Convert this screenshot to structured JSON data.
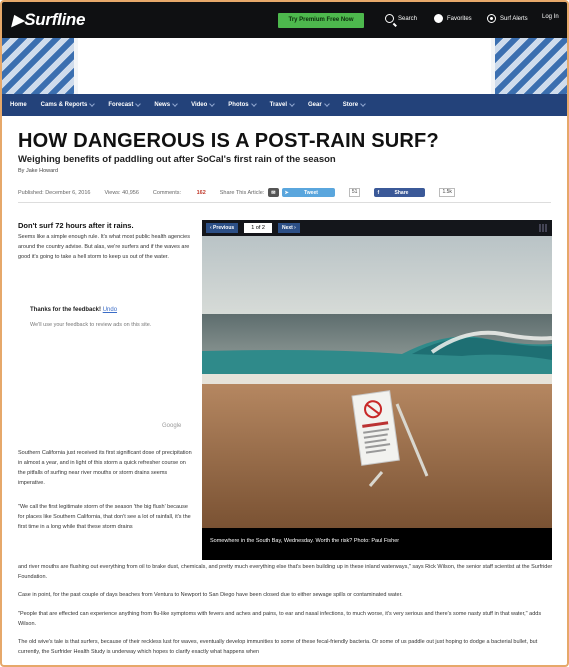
{
  "header": {
    "logo": "Surfline",
    "premium_cta": "Try Premium Free Now",
    "nav": [
      "Search",
      "Favorites",
      "Surf Alerts",
      "Log In"
    ]
  },
  "main_nav": [
    "Home",
    "Cams & Reports",
    "Forecast",
    "News",
    "Video",
    "Photos",
    "Travel",
    "Gear",
    "Store"
  ],
  "article": {
    "title": "HOW DANGEROUS IS A POST-RAIN SURF?",
    "subtitle": "Weighing benefits of paddling out after SoCal's first rain of the season",
    "byline": "By Jake Howard",
    "published": "Published: December 6, 2016",
    "views": "Views: 40,956",
    "comments_label": "Comments:",
    "comments_count": "162",
    "share_label": "Share This Article:",
    "tweet_label": "Tweet",
    "tweet_count": "51",
    "share_btn": "Share",
    "share_count": "1.5k",
    "lead_heading": "Don't surf 72 hours after it rains.",
    "lead_text": "Seems like a simple enough rule. It's what most public health agencies around the country advise. But alas, we're surfers and if the waves are good it's going to take a hell storm to keep us out of the water.",
    "feedback_title": "Thanks for the feedback!",
    "feedback_undo": "Undo",
    "feedback_sub": "We'll use your feedback to review ads on this site.",
    "google": "Google",
    "p2": "Southern California just received its first significant dose of precipitation in almost a year, and in light of this storm a quick refresher course on the pitfalls of surfing near river mouths or storm drains seems imperative.",
    "p3": "\"We call the first legitimate storm of the season 'the big flush' because for places like Southern California, that don't see a lot of rainfall, it's the first time in a long while that these storm drains",
    "p3_cont": "and river mouths are flushing out everything from oil to brake dust, chemicals, and pretty much everything else that's been building up in these inland waterways,\" says Rick Wilson, the senior staff scientist at the Surfrider Foundation.",
    "p4": "Case in point, for the past couple of days beaches from Ventura to Newport to San Diego have been closed due to either sewage spills or contaminated water.",
    "p5": "\"People that are effected can experience anything from flu-like symptoms with fevers and aches and pains, to ear and nasal infections, to much worse, it's very serious and there's some nasty stuff in that water,\" adds Wilson.",
    "p6": "The old wive's tale is that surfers, because of their reckless lust for waves, eventually develop immunities to some of these fecal-friendly bacteria. Or some of us paddle out just hoping to dodge a bacterial bullet, but currently, the Surfrider Health Study is underway which hopes to clarify exactly what happens when"
  },
  "slideshow": {
    "prev": "‹ Previous",
    "counter": "1 of 2",
    "next": "Next ›",
    "caption": "Somewhere in the South Bay, Wednesday. Worth the risk? Photo: Paul Fisher"
  }
}
